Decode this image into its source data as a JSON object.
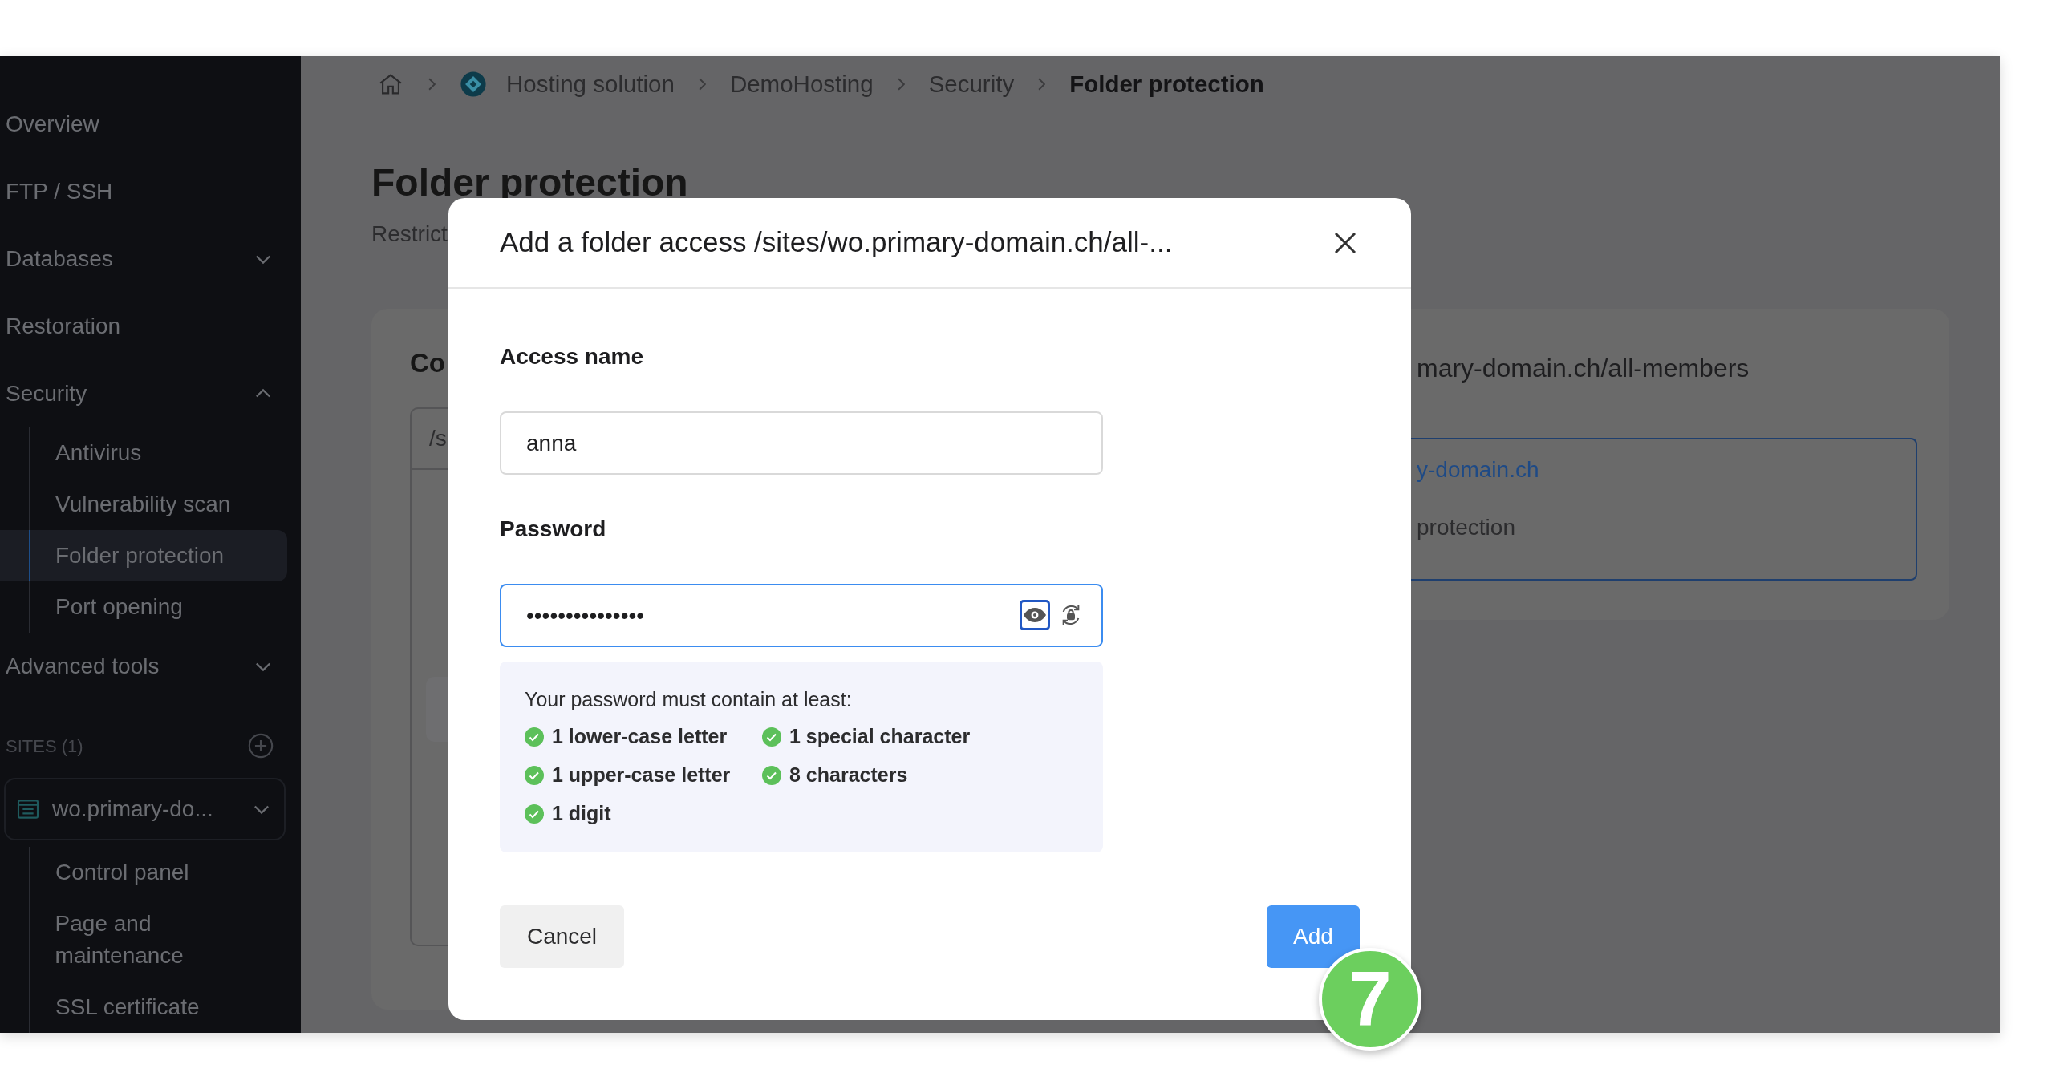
{
  "sidebar": {
    "items": [
      {
        "label": "Overview",
        "kind": "link"
      },
      {
        "label": "FTP / SSH",
        "kind": "link"
      },
      {
        "label": "Databases",
        "kind": "group",
        "expanded": false
      },
      {
        "label": "Restoration",
        "kind": "link"
      },
      {
        "label": "Security",
        "kind": "group",
        "expanded": true,
        "children": [
          {
            "label": "Antivirus",
            "selected": false
          },
          {
            "label": "Vulnerability scan",
            "selected": false
          },
          {
            "label": "Folder protection",
            "selected": true
          },
          {
            "label": "Port opening",
            "selected": false
          }
        ]
      },
      {
        "label": "Advanced tools",
        "kind": "group",
        "expanded": false
      }
    ],
    "sites_label": "SITES (1)",
    "site": {
      "label": "wo.primary-do...",
      "children": [
        {
          "label": "Control panel",
          "selected": false
        },
        {
          "label": "Page and maintenance",
          "selected": false
        },
        {
          "label": "SSL certificate",
          "selected": false
        }
      ]
    }
  },
  "breadcrumb": [
    {
      "kind": "home"
    },
    {
      "kind": "logo",
      "label": "Hosting solution",
      "current": false
    },
    {
      "kind": "text",
      "label": "DemoHosting",
      "current": false
    },
    {
      "kind": "text",
      "label": "Security",
      "current": false
    },
    {
      "kind": "text",
      "label": "Folder protection",
      "current": true
    }
  ],
  "page": {
    "title": "Folder protection",
    "subtitle": "Restrict",
    "card_heading": "Co",
    "list_header": "/s",
    "detail_heading": "mary-domain.ch/all-members",
    "detail_link": "y-domain.ch",
    "detail_text": "protection"
  },
  "modal": {
    "title": "Add a folder access /sites/wo.primary-domain.ch/all-...",
    "fields": [
      {
        "label": "Access name",
        "kind": "text",
        "value": "anna",
        "focused": false
      },
      {
        "label": "Password",
        "kind": "password",
        "value": "•••••••••••••••",
        "focused": true,
        "reveal_focused": true
      }
    ],
    "requirements": {
      "intro": "Your password must contain at least:",
      "items": [
        {
          "label": "1 lower-case letter",
          "met": true
        },
        {
          "label": "1 special character",
          "met": true
        },
        {
          "label": "1 upper-case letter",
          "met": true
        },
        {
          "label": "8 characters",
          "met": true
        },
        {
          "label": "1 digit",
          "met": true
        }
      ]
    },
    "buttons": [
      {
        "label": "Cancel",
        "kind": "secondary"
      },
      {
        "label": "Add",
        "kind": "primary"
      }
    ]
  },
  "step_badge": "7"
}
